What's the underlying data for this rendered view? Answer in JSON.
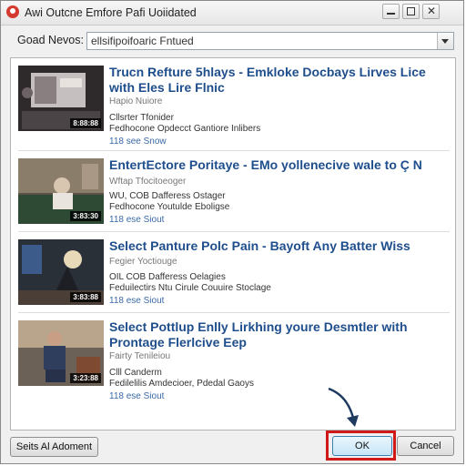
{
  "window": {
    "title": "Awi Outcne Emfore Pafi Uoiidated",
    "controls": {
      "minimize_icon": "minimize-icon",
      "maximize_icon": "maximize-icon",
      "close_glyph": "✕"
    }
  },
  "filter": {
    "label": "Goad Nevos:",
    "value": "ellsifipoifoaric Fntued"
  },
  "videos": [
    {
      "title": "Trucn Refture 5hlays - Emkloke Docbays Lirves Lice with Eles Lire Flnic",
      "line1": "Hapio Nuiore",
      "line2": "Cllsrter Tfonider",
      "line3": "Fedhocone Opdecct Gantiore Inlibers",
      "line4": "118 see Snow",
      "duration": "8:88:88",
      "colors": {
        "bg": "#2e2a2c",
        "screen": "#c6bfbf"
      }
    },
    {
      "title": "EntertEctore Poritaye - EMo yollenecive wale to Ç N",
      "line1": "Wftap Tfocitoeoger",
      "line2": "WU, COB Dafferess Ostager",
      "line3": "Fedhocone Youtulde Eboligse",
      "line4": "118 ese Siout",
      "duration": "3:83:30",
      "colors": {
        "bg": "#5a5147",
        "screen": "#8a7d6a"
      }
    },
    {
      "title": "Select Panture Polc Pain - Bayoft Any Batter Wiss",
      "line1": "Fegier Yoctiouge",
      "line2": "OIL COB Dafferess Oelagies",
      "line3": "Feduilectirs Ntu Cirule Couuire Stoclage",
      "line4": "118 ese Siout",
      "duration": "3:83:88",
      "colors": {
        "bg": "#2a3038",
        "screen": "#3c5a8a"
      }
    },
    {
      "title": "Select Pottlup Enlly Lirkhing youre Desmtler with Prontage Flerlcive Eep",
      "line1": "Fairty Tenileiou",
      "line2": "Clll Canderm",
      "line3": "Fedilelilis Amdecioer, Pdedal Gaoys",
      "line4": "118 ese Siout",
      "duration": "3:23:88",
      "colors": {
        "bg": "#6b6157",
        "screen": "#b9a58b"
      }
    }
  ],
  "footer": {
    "select_all_label": "Seits Al Adoment",
    "ok_label": "OK",
    "cancel_label": "Cancel"
  },
  "accent": {
    "highlight": "#d01a1a",
    "title_blue": "#1f4e8c",
    "link_blue": "#3a6aa8"
  }
}
